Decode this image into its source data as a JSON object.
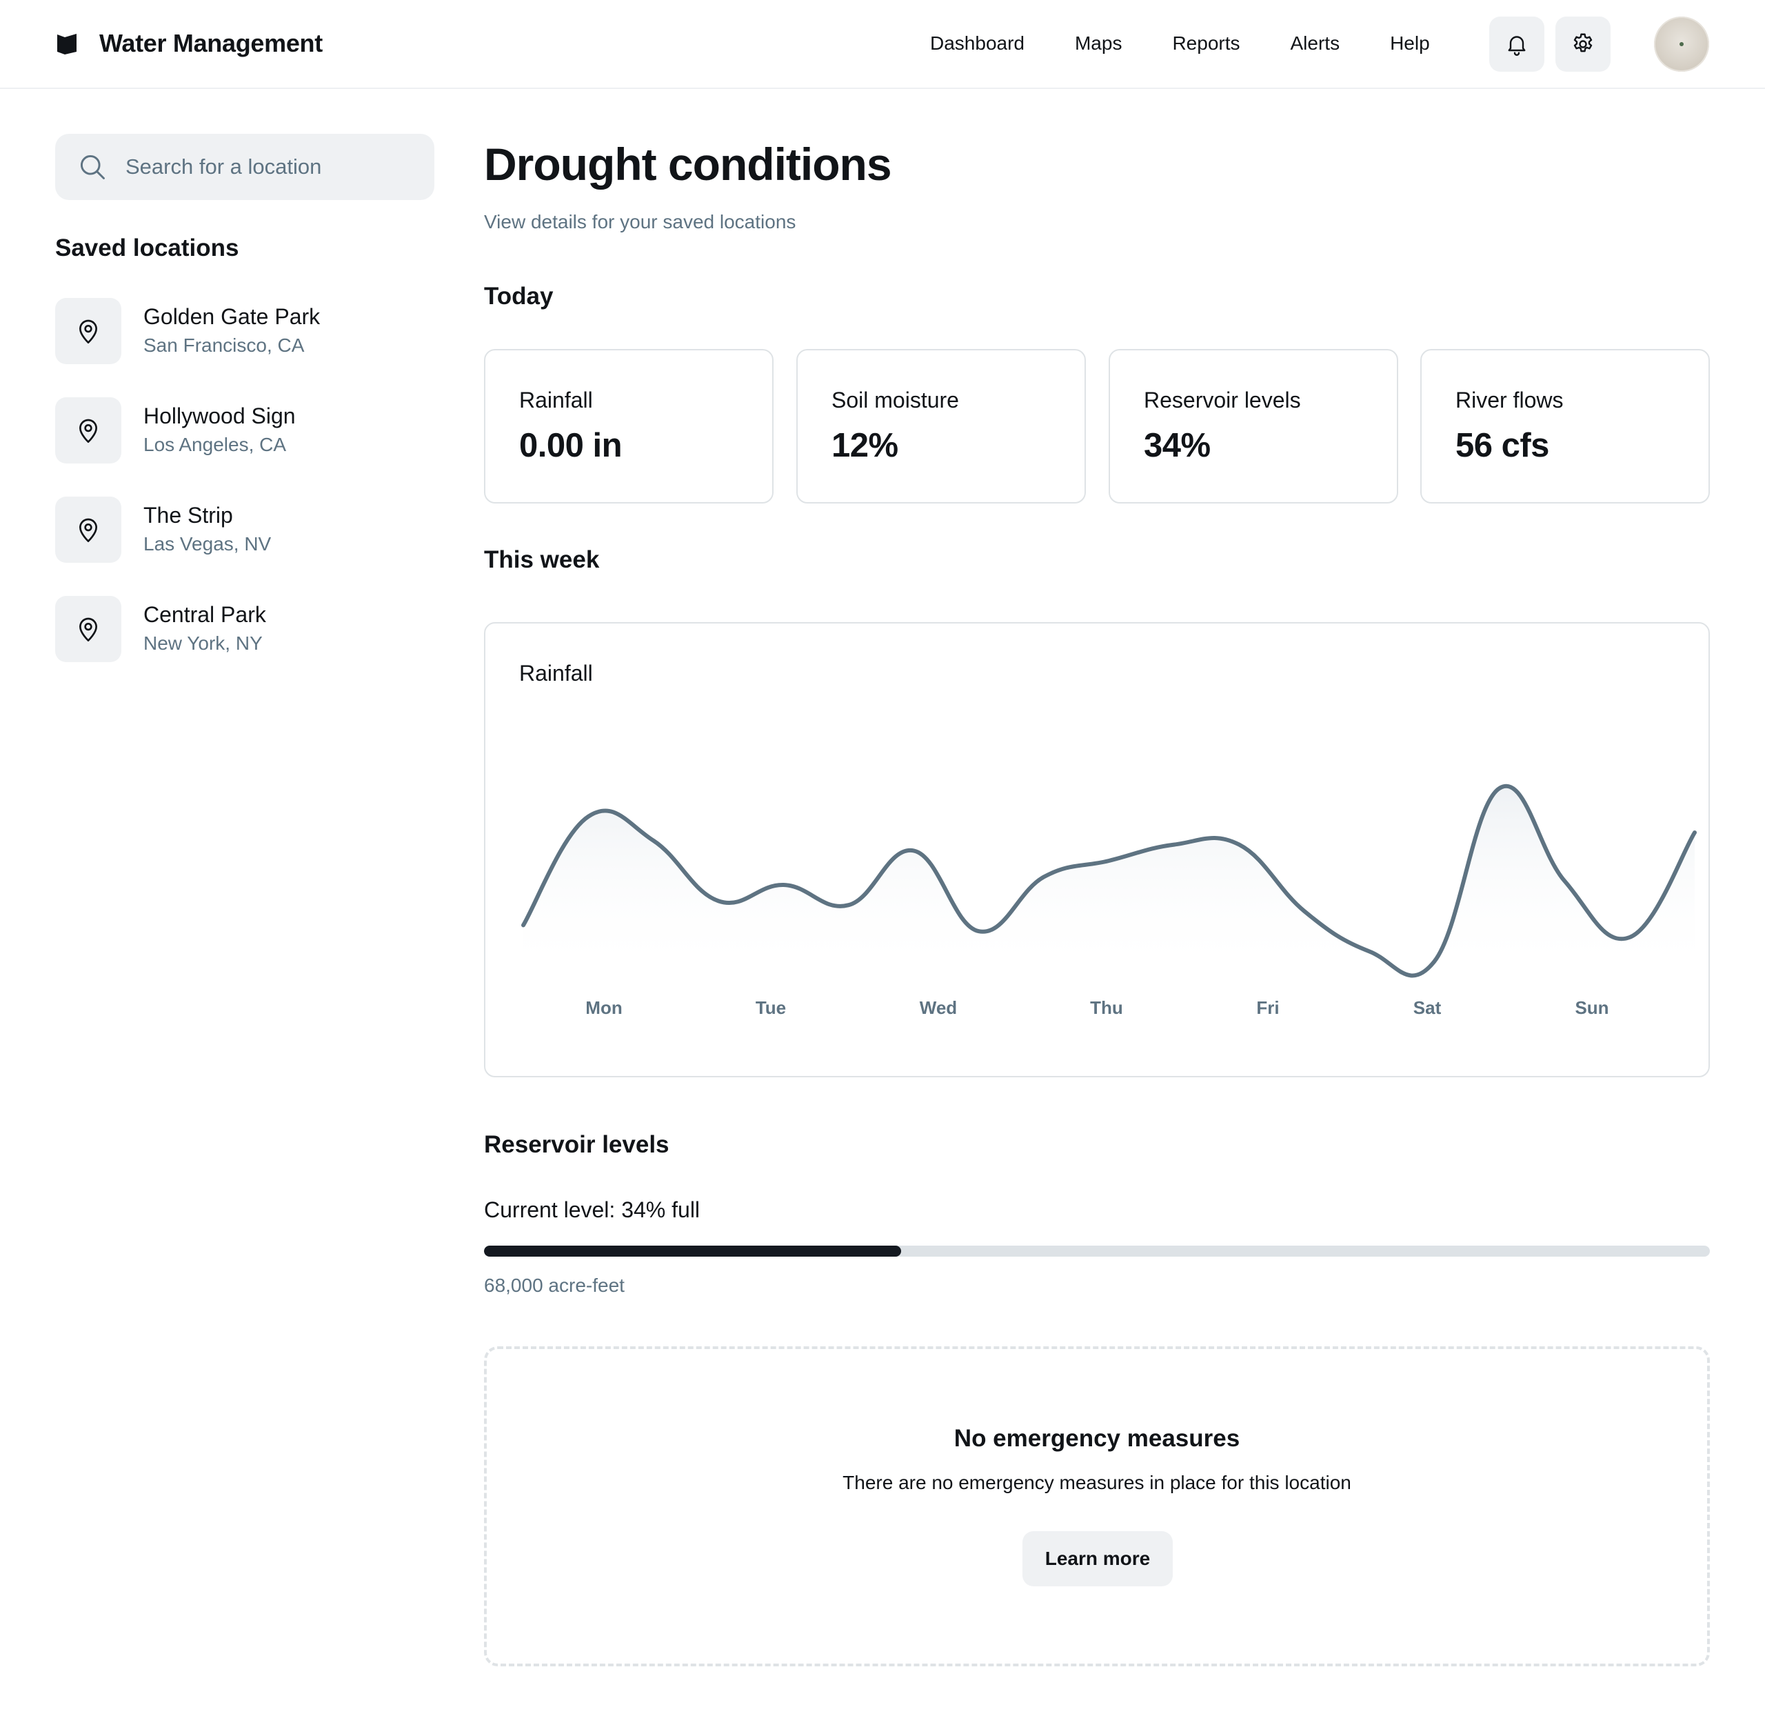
{
  "header": {
    "app_title": "Water Management",
    "nav": [
      "Dashboard",
      "Maps",
      "Reports",
      "Alerts",
      "Help"
    ]
  },
  "sidebar": {
    "search_placeholder": "Search for a location",
    "saved_title": "Saved locations",
    "locations": [
      {
        "name": "Golden Gate Park",
        "place": "San Francisco, CA"
      },
      {
        "name": "Hollywood Sign",
        "place": "Los Angeles, CA"
      },
      {
        "name": "The Strip",
        "place": "Las Vegas, NV"
      },
      {
        "name": "Central Park",
        "place": "New York, NY"
      }
    ]
  },
  "main": {
    "title": "Drought conditions",
    "subtitle": "View details for your saved locations",
    "today_title": "Today",
    "stats": [
      {
        "label": "Rainfall",
        "value": "0.00 in"
      },
      {
        "label": "Soil moisture",
        "value": "12%"
      },
      {
        "label": "Reservoir levels",
        "value": "34%"
      },
      {
        "label": "River flows",
        "value": "56 cfs"
      }
    ],
    "week_title": "This week",
    "reservoir": {
      "title": "Reservoir levels",
      "current_label": "Current level: 34% full",
      "level_fraction": 0.34,
      "volume": "68,000 acre-feet"
    },
    "emergency": {
      "title": "No emergency measures",
      "text": "There are no emergency measures in place for this location",
      "button": "Learn more"
    }
  },
  "chart_data": {
    "type": "area",
    "title": "Rainfall",
    "categories": [
      "Mon",
      "Tue",
      "Wed",
      "Thu",
      "Fri",
      "Sat",
      "Sun"
    ],
    "series": [
      {
        "values": [
          0.18,
          0.72,
          0.6,
          0.3,
          0.38,
          0.28,
          0.55,
          0.15,
          0.42,
          0.5,
          0.58,
          0.58,
          0.25,
          0.05,
          0.0,
          0.86,
          0.4,
          0.12,
          0.64
        ]
      }
    ],
    "xlabel": "",
    "ylabel": "",
    "grid": false,
    "colors": {
      "line": "#5e7382",
      "fill_top": "#eef1f4"
    }
  },
  "colors": {
    "accent_dark": "#141920",
    "muted_text": "#5e7382",
    "surface": "#eff1f3",
    "border": "#dfe3e6"
  },
  "icons": {
    "brand": "flag-icon",
    "notifications": "bell-icon",
    "settings": "gear-icon",
    "search": "search-icon",
    "location": "map-pin-icon"
  }
}
